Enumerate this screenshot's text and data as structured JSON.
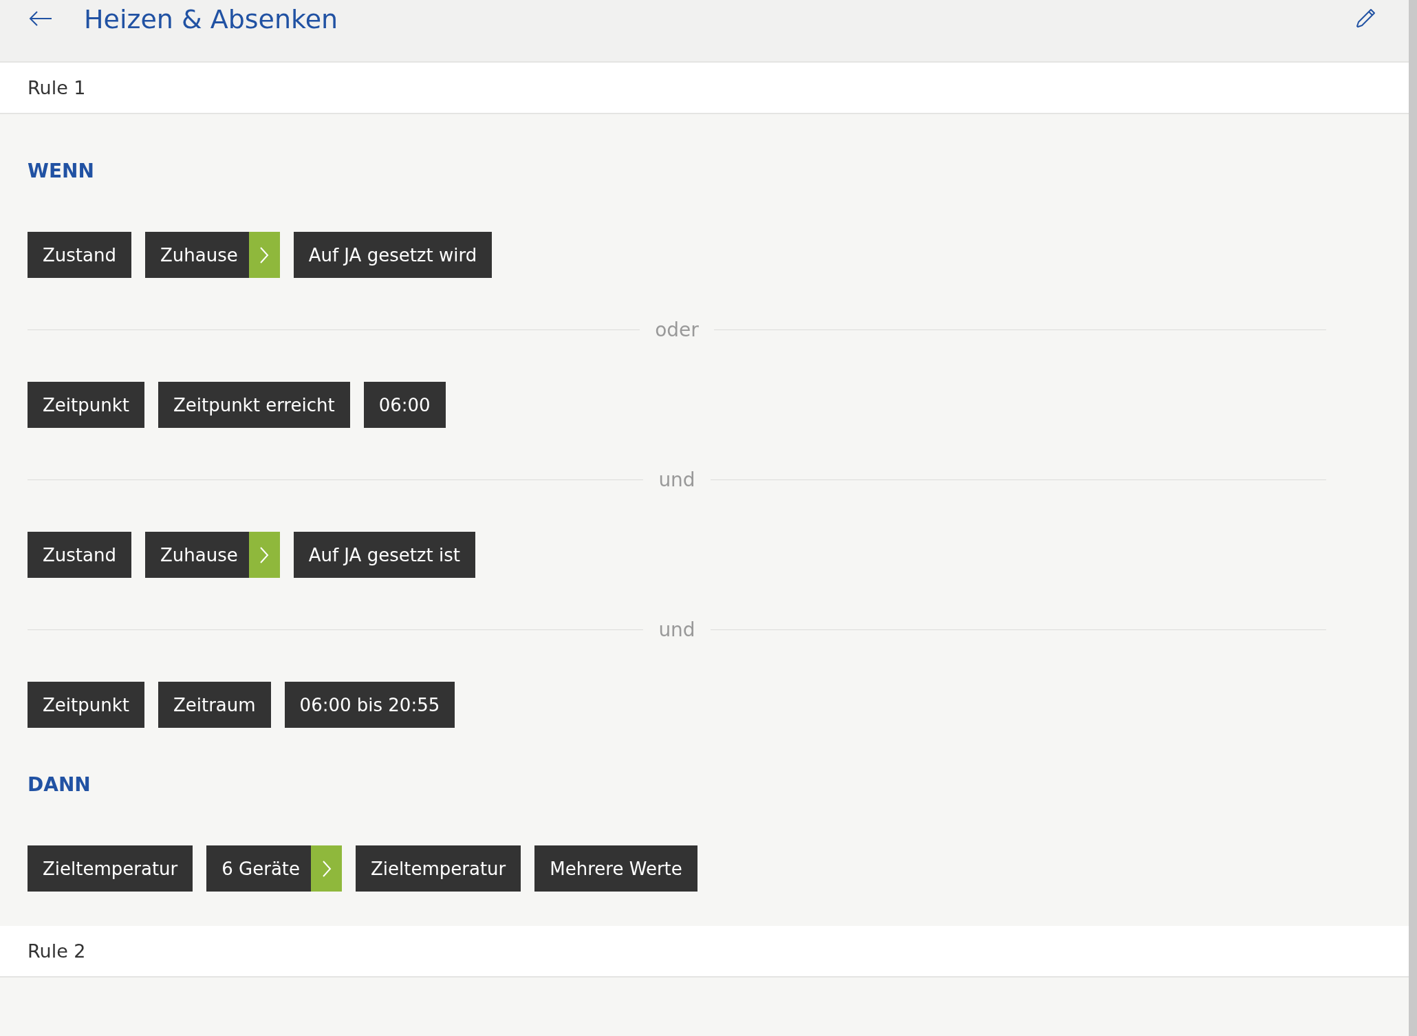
{
  "header": {
    "title": "Heizen & Absenken"
  },
  "rules": [
    {
      "label": "Rule 1",
      "sections": [
        {
          "heading": "WENN",
          "items": [
            {
              "kind": "row",
              "chips": [
                {
                  "label": "Zustand",
                  "kind": "plain"
                },
                {
                  "label": "Zuhause",
                  "kind": "link"
                },
                {
                  "label": "Auf JA gesetzt wird",
                  "kind": "plain"
                }
              ]
            },
            {
              "kind": "connector",
              "label": "oder"
            },
            {
              "kind": "row",
              "chips": [
                {
                  "label": "Zeitpunkt",
                  "kind": "plain"
                },
                {
                  "label": "Zeitpunkt erreicht",
                  "kind": "plain"
                },
                {
                  "label": "06:00",
                  "kind": "plain"
                }
              ]
            },
            {
              "kind": "connector",
              "label": "und"
            },
            {
              "kind": "row",
              "chips": [
                {
                  "label": "Zustand",
                  "kind": "plain"
                },
                {
                  "label": "Zuhause",
                  "kind": "link"
                },
                {
                  "label": "Auf JA gesetzt ist",
                  "kind": "plain"
                }
              ]
            },
            {
              "kind": "connector",
              "label": "und"
            },
            {
              "kind": "row",
              "chips": [
                {
                  "label": "Zeitpunkt",
                  "kind": "plain"
                },
                {
                  "label": "Zeitraum",
                  "kind": "plain"
                },
                {
                  "label": "06:00 bis 20:55",
                  "kind": "plain"
                }
              ]
            }
          ]
        },
        {
          "heading": "DANN",
          "items": [
            {
              "kind": "row",
              "chips": [
                {
                  "label": "Zieltemperatur",
                  "kind": "plain"
                },
                {
                  "label": "6 Geräte",
                  "kind": "link"
                },
                {
                  "label": "Zieltemperatur",
                  "kind": "plain"
                },
                {
                  "label": "Mehrere Werte",
                  "kind": "plain"
                }
              ]
            }
          ]
        }
      ]
    },
    {
      "label": "Rule 2"
    }
  ]
}
